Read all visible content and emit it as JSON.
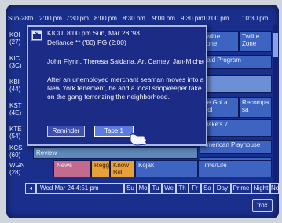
{
  "header": {
    "date_label": "Sun-28th",
    "times": [
      "2:00 pm",
      "7:30 pm",
      "8:00 pm",
      "8:30 pm",
      "9:00 pm",
      "9:30 pm",
      "10:00 pm",
      "10:30 pm"
    ]
  },
  "rows": [
    {
      "channel": "KOI",
      "number": "(27)"
    },
    {
      "channel": "KIC",
      "number": "(3C)"
    },
    {
      "channel": "KBI",
      "number": "(44)"
    },
    {
      "channel": "KST",
      "number": "(4E)"
    },
    {
      "channel": "KTE",
      "number": "(54)"
    },
    {
      "channel": "KCS",
      "number": "(60)"
    },
    {
      "channel": "WGN",
      "number": "(28)"
    }
  ],
  "right_cells": {
    "twilite1": "Twilite Zone",
    "twilite2": "Twilite Zone",
    "paid": "Paid Program",
    "degol": "De Gol a Gol",
    "recompa": "Recompa sa",
    "blakes": "Blake's 7",
    "american": "American Playhouse"
  },
  "bottom_cells": {
    "review": "Review",
    "news": "News",
    "reggie": "Reggie",
    "knowbull": "Know Bull",
    "kojak": "Kojak",
    "timelife": "Time/Life"
  },
  "popup": {
    "line1": "KICU: 8:00 pm Sun, Mar 28 '93",
    "line2": "Defiance ** ('80) PG (2:00)",
    "cast": "John Flynn, Theresa Saldana, Art Carney, Jan-Michael",
    "description": "After an unemployed merchant seaman moves into a New York tenement, he and a local shopkeeper take on the gang terrorizing the neighborhood.",
    "reminder_label": "Reminder",
    "tape_label": "Tape 1"
  },
  "footer": {
    "datetime": "Wed Mar 24 4:51 pm",
    "days": [
      "Su",
      "Mo",
      "Tu",
      "We",
      "Th",
      "Fr",
      "Sa"
    ],
    "parts": [
      "Day",
      "Prime",
      "Night",
      "Now"
    ],
    "logo": "frox"
  }
}
